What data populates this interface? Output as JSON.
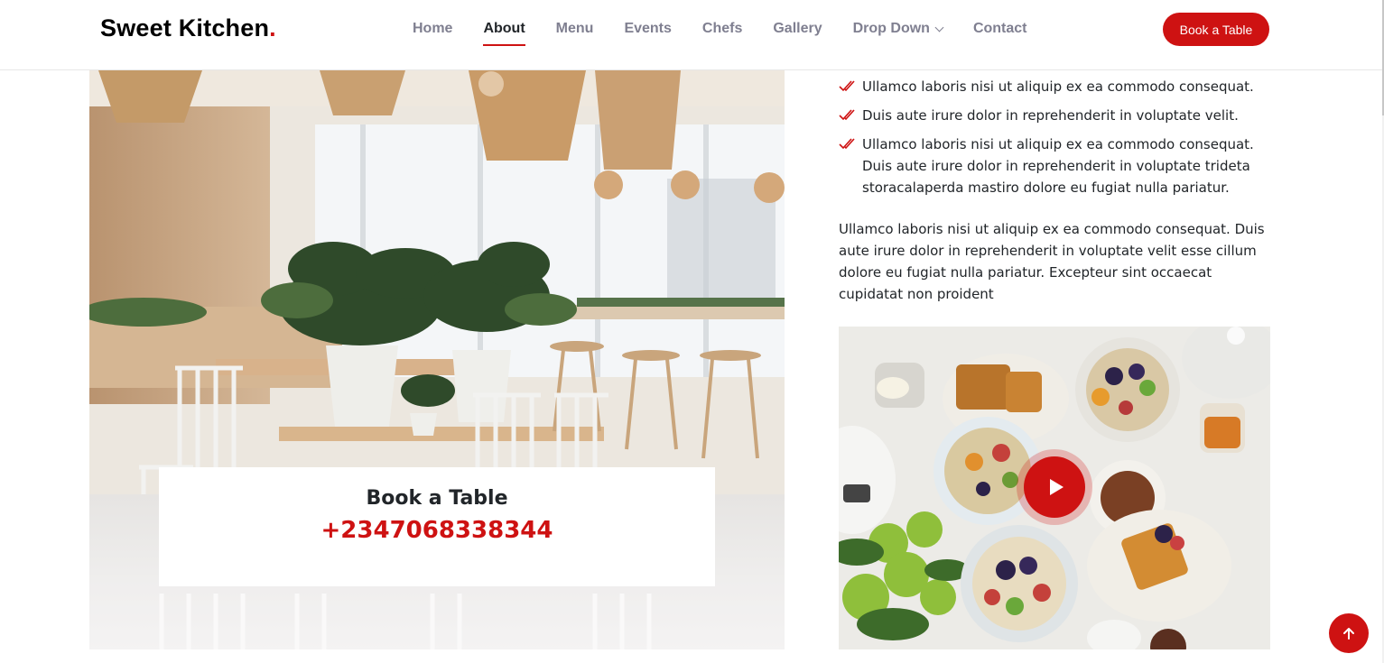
{
  "brand": {
    "name": "Sweet Kitchen",
    "dot": "."
  },
  "nav": {
    "items": [
      {
        "label": "Home"
      },
      {
        "label": "About",
        "active": true
      },
      {
        "label": "Menu"
      },
      {
        "label": "Events"
      },
      {
        "label": "Chefs"
      },
      {
        "label": "Gallery"
      },
      {
        "label": "Drop Down",
        "dropdown": true
      },
      {
        "label": "Contact"
      }
    ],
    "cta": "Book a Table"
  },
  "booking": {
    "title": "Book a Table",
    "phone": "+2347068338344"
  },
  "about": {
    "checklist": [
      "Ullamco laboris nisi ut aliquip ex ea commodo consequat.",
      "Duis aute irure dolor in reprehenderit in voluptate velit.",
      "Ullamco laboris nisi ut aliquip ex ea commodo consequat. Duis aute irure dolor in reprehenderit in voluptate trideta storacalaperda mastiro dolore eu fugiat nulla pariatur."
    ],
    "paragraph": "Ullamco laboris nisi ut aliquip ex ea commodo consequat. Duis aute irure dolor in reprehenderit in voluptate velit esse cillum dolore eu fugiat nulla pariatur. Excepteur sint occaecat cupidatat non proident"
  },
  "icons": {
    "check": "double-check-icon",
    "play": "play-icon",
    "scroll_top": "arrow-up-icon",
    "dropdown": "chevron-down-icon"
  },
  "colors": {
    "accent": "#ce1212",
    "text": "#212529",
    "nav_text": "#7f7f90"
  }
}
